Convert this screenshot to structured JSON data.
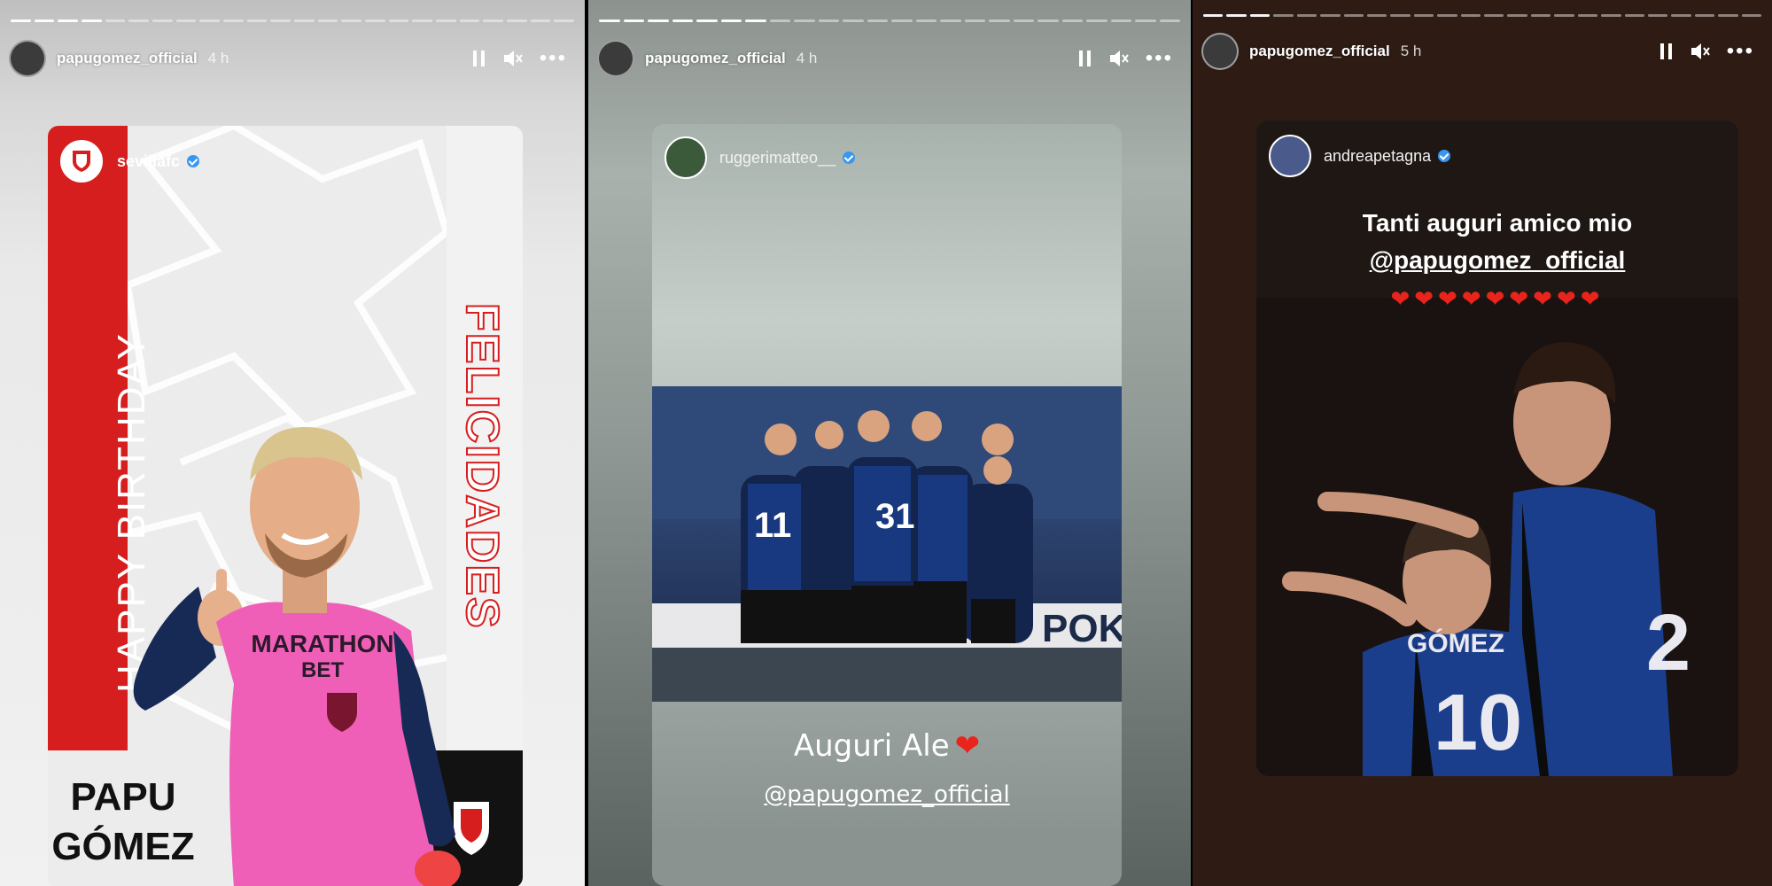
{
  "stories": [
    {
      "username": "papugomez_official",
      "time": "4 h",
      "card": {
        "username": "sevillafc",
        "vertical_left": "HAPPY BIRTHDAY",
        "vertical_right": "FELICIDADES",
        "name_line1": "PAPU",
        "name_line2": "GÓMEZ",
        "sponsor_line1": "MARATHON",
        "sponsor_line2": "BET"
      }
    },
    {
      "username": "papugomez_official",
      "time": "4 h",
      "card": {
        "username": "ruggerimatteo__",
        "caption": "Auguri Ale",
        "mention": "@papugomez_official",
        "jersey_numbers": [
          "11",
          "31"
        ],
        "banner_text": "POK"
      }
    },
    {
      "username": "papugomez_official",
      "time": "5 h",
      "card": {
        "username": "andreapetagna",
        "line1": "Tanti auguri amico mio",
        "mention": "@papugomez_official",
        "hearts": "❤❤❤❤❤❤❤❤❤",
        "jersey_name": "GÓMEZ",
        "jersey_number_front": "10",
        "jersey_number_back": "2"
      }
    }
  ],
  "colors": {
    "sevilla_red": "#d71e1e",
    "atalanta_blue": "#1a3e8c",
    "verified_blue": "#3897f0"
  },
  "icons": [
    "pause-icon",
    "mute-icon",
    "more-icon",
    "verified-icon",
    "heart-icon"
  ]
}
